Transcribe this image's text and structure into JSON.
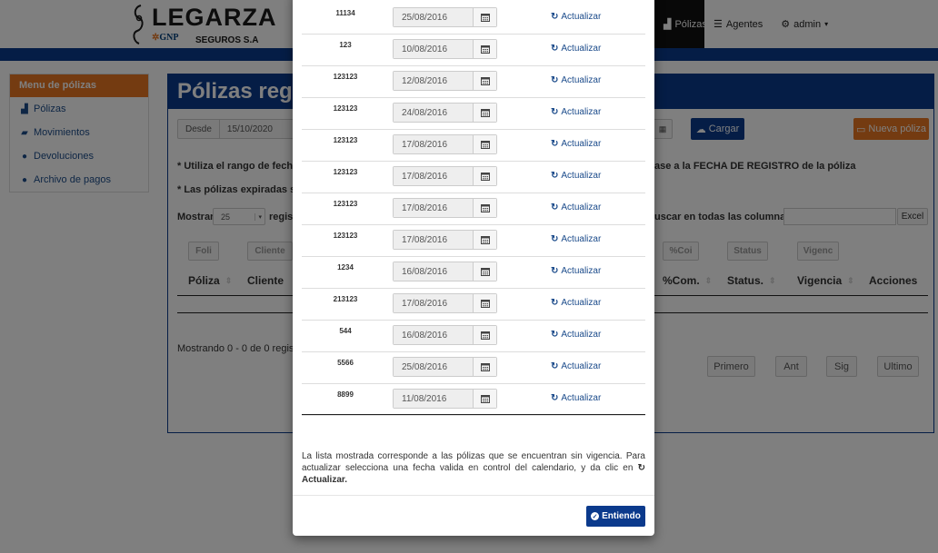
{
  "brand": {
    "name": "LEGARZA",
    "partner": "GNP",
    "partner_sub": "SEGUROS S.A"
  },
  "topnav": {
    "items": [
      {
        "label": "Pólizas",
        "icon": "bar-chart-icon"
      },
      {
        "label": "Agentes",
        "icon": "list-icon"
      },
      {
        "label": "admin",
        "icon": "gear-icon"
      }
    ]
  },
  "sidebar": {
    "title": "Menu de pólizas",
    "items": [
      {
        "label": "Pólizas",
        "icon": "bar-chart-icon"
      },
      {
        "label": "Movimientos",
        "icon": "book-icon"
      },
      {
        "label": "Devoluciones",
        "icon": "info-icon"
      },
      {
        "label": "Archivo de pagos",
        "icon": "info-icon"
      }
    ]
  },
  "main": {
    "title": "Pólizas regis",
    "desde_label": "Desde",
    "desde_value": "15/10/2020",
    "cargar_label": "Cargar",
    "nueva_label": "Nueva póliza",
    "note1_left": "* Utiliza el rango de fechas",
    "note1_right": "ase a la FECHA DE REGISTRO de la póliza",
    "note2_left": "* Las pólizas expiradas se",
    "mostrar_label": "Mostrar",
    "mostrar_value": "25",
    "regist_label": "regist",
    "buscar_label": "uscar en todas las columnas:",
    "excel_label": "Excel",
    "filters": [
      "Foli",
      "Cliente",
      "%Coi",
      "Status",
      "Vigenc"
    ],
    "headers": [
      "Póliza",
      "Cliente",
      "%Com.",
      "Status.",
      "Vigencia",
      "Acciones"
    ],
    "showing": "Mostrando 0 - 0 de 0 registro",
    "pagination": [
      "Primero",
      "Ant",
      "Sig",
      "Ultimo"
    ]
  },
  "modal": {
    "update_label": "Actualizar",
    "rows": [
      {
        "id": "11134",
        "date": "25/08/2016"
      },
      {
        "id": "123",
        "date": "10/08/2016"
      },
      {
        "id": "123123",
        "date": "12/08/2016"
      },
      {
        "id": "123123",
        "date": "24/08/2016"
      },
      {
        "id": "123123",
        "date": "17/08/2016"
      },
      {
        "id": "123123",
        "date": "17/08/2016"
      },
      {
        "id": "123123",
        "date": "17/08/2016"
      },
      {
        "id": "123123",
        "date": "17/08/2016"
      },
      {
        "id": "1234",
        "date": "16/08/2016"
      },
      {
        "id": "213123",
        "date": "17/08/2016"
      },
      {
        "id": "544",
        "date": "16/08/2016"
      },
      {
        "id": "5566",
        "date": "25/08/2016"
      },
      {
        "id": "8899",
        "date": "11/08/2016"
      }
    ],
    "note": "La lista mostrada corresponde a las pólizas que se encuentran sin vigencia. Para actualizar selecciona una fecha valida en control del calendario, y da clic en",
    "note_strong": "Actualizar.",
    "ok_label": "Entiendo"
  },
  "colors": {
    "primary": "#0b3a8c",
    "accent": "#e87722",
    "link": "#1a4a8a"
  }
}
